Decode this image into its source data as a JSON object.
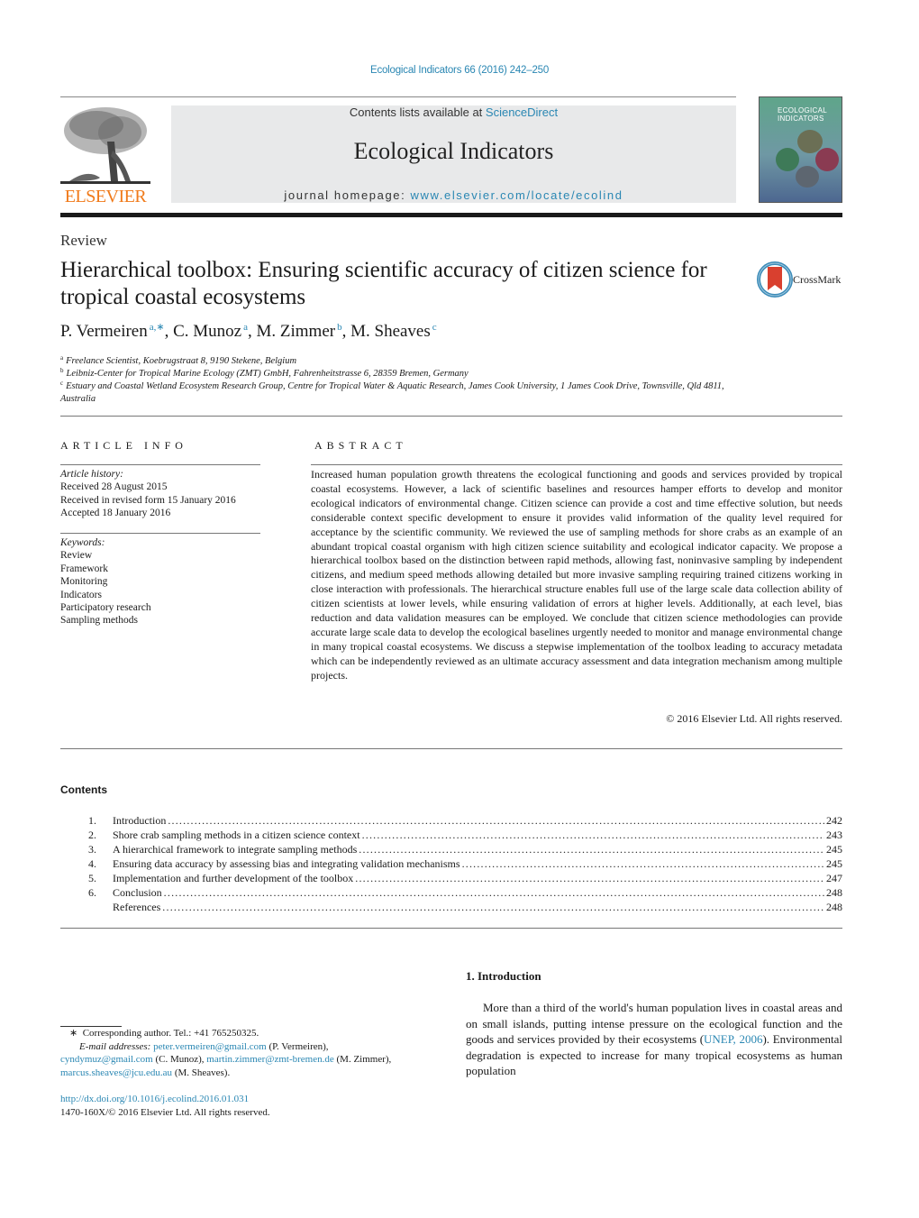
{
  "journal_reference": "Ecological Indicators 66 (2016) 242–250",
  "header": {
    "publisher_logo_text": "ELSEVIER",
    "contents_prefix": "Contents lists available at ",
    "contents_link": "ScienceDirect",
    "journal_title": "Ecological Indicators",
    "homepage_prefix": "journal homepage: ",
    "homepage_link": "www.elsevier.com/locate/ecolind",
    "cover_title_line1": "ECOLOGICAL",
    "cover_title_line2": "INDICATORS"
  },
  "article": {
    "type": "Review",
    "title": "Hierarchical toolbox: Ensuring scientific accuracy of citizen science for tropical coastal ecosystems",
    "crossmark_label": "CrossMark",
    "authors": [
      {
        "name": "P. Vermeiren",
        "affil": "a,∗"
      },
      {
        "name": "C. Munoz",
        "affil": "a"
      },
      {
        "name": "M. Zimmer",
        "affil": "b"
      },
      {
        "name": "M. Sheaves",
        "affil": "c"
      }
    ],
    "affiliations": [
      {
        "key": "a",
        "text": "Freelance Scientist, Koebrugstraat 8, 9190 Stekene, Belgium"
      },
      {
        "key": "b",
        "text": "Leibniz-Center for Tropical Marine Ecology (ZMT) GmbH, Fahrenheitstrasse 6, 28359 Bremen, Germany"
      },
      {
        "key": "c",
        "text": "Estuary and Coastal Wetland Ecosystem Research Group, Centre for Tropical Water & Aquatic Research, James Cook University, 1 James Cook Drive, Townsville, Qld 4811, Australia"
      }
    ]
  },
  "article_info": {
    "heading": "ARTICLE INFO",
    "history_label": "Article history:",
    "history": [
      "Received 28 August 2015",
      "Received in revised form 15 January 2016",
      "Accepted 18 January 2016"
    ],
    "keywords_label": "Keywords:",
    "keywords": [
      "Review",
      "Framework",
      "Monitoring",
      "Indicators",
      "Participatory research",
      "Sampling methods"
    ]
  },
  "abstract": {
    "heading": "ABSTRACT",
    "text": "Increased human population growth threatens the ecological functioning and goods and services provided by tropical coastal ecosystems. However, a lack of scientific baselines and resources hamper efforts to develop and monitor ecological indicators of environmental change. Citizen science can provide a cost and time effective solution, but needs considerable context specific development to ensure it provides valid information of the quality level required for acceptance by the scientific community. We reviewed the use of sampling methods for shore crabs as an example of an abundant tropical coastal organism with high citizen science suitability and ecological indicator capacity. We propose a hierarchical toolbox based on the distinction between rapid methods, allowing fast, noninvasive sampling by independent citizens, and medium speed methods allowing detailed but more invasive sampling requiring trained citizens working in close interaction with professionals. The hierarchical structure enables full use of the large scale data collection ability of citizen scientists at lower levels, while ensuring validation of errors at higher levels. Additionally, at each level, bias reduction and data validation measures can be employed. We conclude that citizen science methodologies can provide accurate large scale data to develop the ecological baselines urgently needed to monitor and manage environmental change in many tropical coastal ecosystems. We discuss a stepwise implementation of the toolbox leading to accuracy metadata which can be independently reviewed as an ultimate accuracy assessment and data integration mechanism among multiple projects.",
    "copyright": "© 2016 Elsevier Ltd. All rights reserved."
  },
  "contents": {
    "heading": "Contents",
    "items": [
      {
        "num": "1.",
        "label": "Introduction",
        "page": "242"
      },
      {
        "num": "2.",
        "label": "Shore crab sampling methods in a citizen science context",
        "page": "243"
      },
      {
        "num": "3.",
        "label": "A hierarchical framework to integrate sampling methods",
        "page": "245"
      },
      {
        "num": "4.",
        "label": "Ensuring data accuracy by assessing bias and integrating validation mechanisms",
        "page": "245"
      },
      {
        "num": "5.",
        "label": "Implementation and further development of the toolbox",
        "page": "247"
      },
      {
        "num": "6.",
        "label": "Conclusion",
        "page": "248"
      },
      {
        "num": "",
        "label": "References",
        "page": "248"
      }
    ]
  },
  "footnote": {
    "star": "∗",
    "corresponding": "Corresponding author. Tel.: +41 765250325.",
    "email_label": "E-mail addresses:",
    "emails": [
      {
        "address": "peter.vermeiren@gmail.com",
        "name": "(P. Vermeiren),"
      },
      {
        "address": "cyndymuz@gmail.com",
        "name": "(C. Munoz),"
      },
      {
        "address": "martin.zimmer@zmt-bremen.de",
        "name": "(M. Zimmer),"
      },
      {
        "address": "marcus.sheaves@jcu.edu.au",
        "name": "(M. Sheaves)."
      }
    ],
    "doi": "http://dx.doi.org/10.1016/j.ecolind.2016.01.031",
    "issn_copyright": "1470-160X/© 2016 Elsevier Ltd. All rights reserved."
  },
  "introduction": {
    "heading": "1.  Introduction",
    "text_before_cite": "More than a third of the world's human population lives in coastal areas and on small islands, putting intense pressure on the ecological function and the goods and services provided by their ecosystems (",
    "citation": "UNEP, 2006",
    "text_after_cite": "). Environmental degradation is expected to increase for many tropical ecosystems as human population"
  },
  "colors": {
    "link": "#2a87b3",
    "elsevier_orange": "#f07a1a",
    "banner_bg": "#e8e9ea"
  }
}
